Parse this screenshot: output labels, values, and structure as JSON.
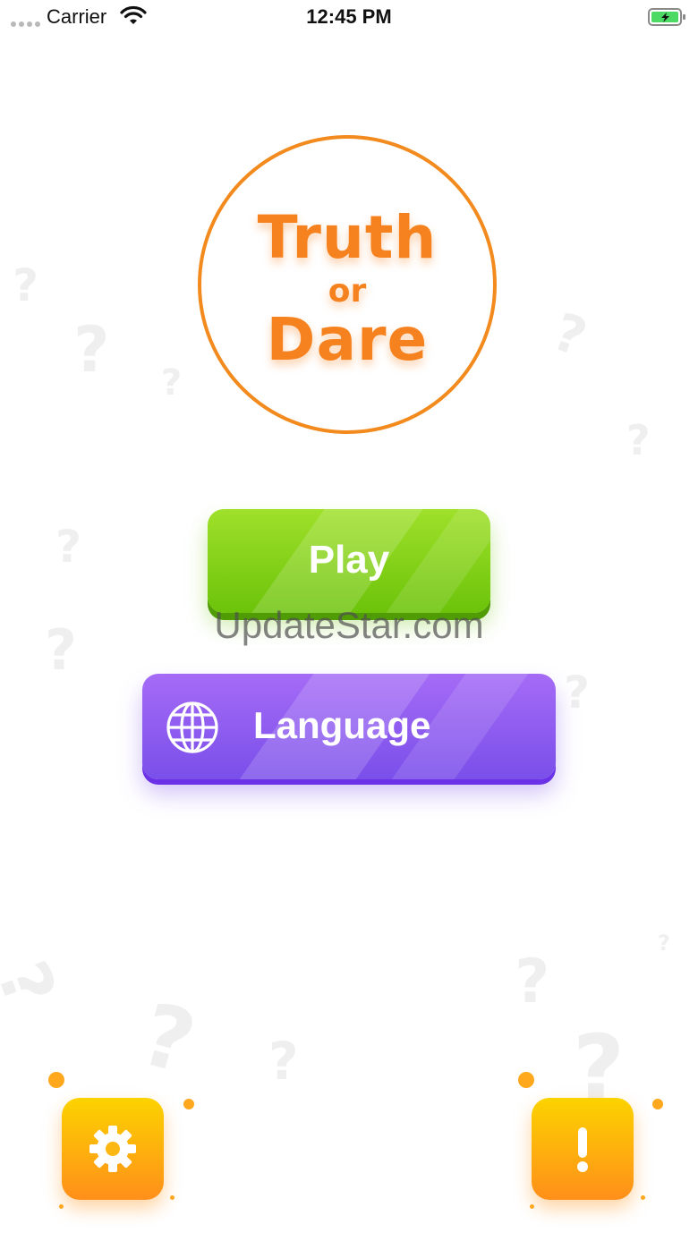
{
  "status_bar": {
    "carrier": "Carrier",
    "time": "12:45 PM",
    "battery_state": "charging"
  },
  "logo": {
    "line1": "Truth",
    "line2": "or",
    "line3": "Dare"
  },
  "buttons": {
    "play_label": "Play",
    "language_label": "Language"
  },
  "watermark": "UpdateStar.com",
  "icons": {
    "language": "globe-icon",
    "settings": "gear-icon",
    "info": "exclamation-icon"
  },
  "colors": {
    "accent_orange": "#f5821f",
    "play_green": "#6cc30a",
    "language_purple": "#7a4fea",
    "tile_yellow": "#fcd300"
  }
}
